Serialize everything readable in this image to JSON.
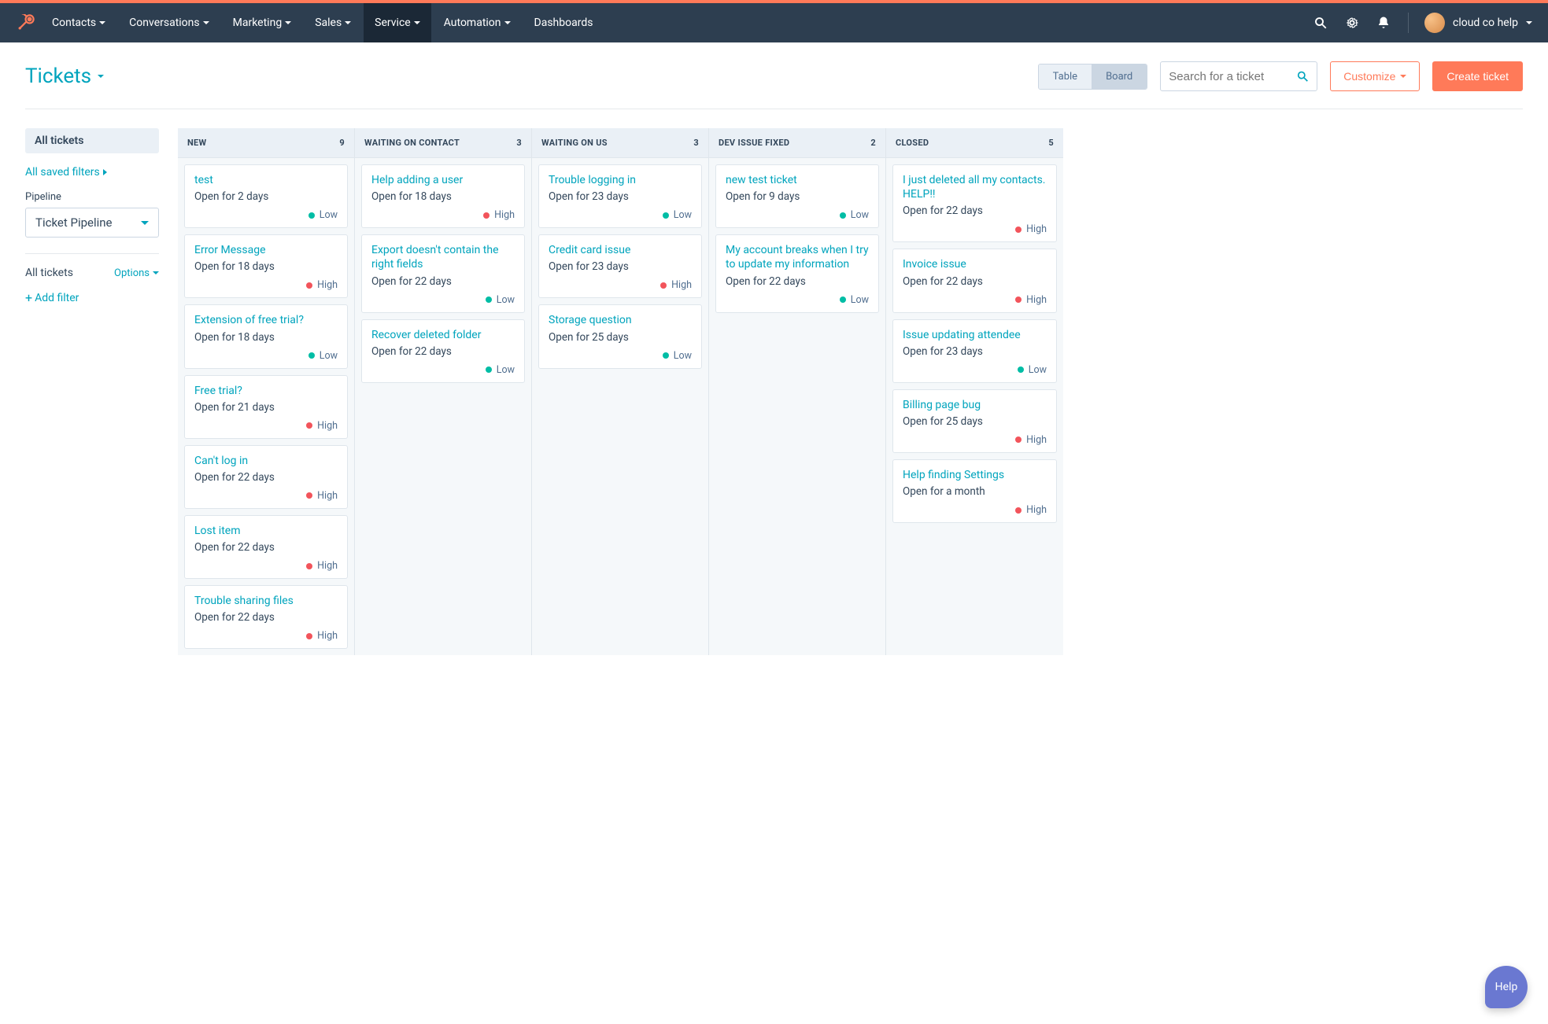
{
  "nav": {
    "items": [
      {
        "label": "Contacts"
      },
      {
        "label": "Conversations"
      },
      {
        "label": "Marketing"
      },
      {
        "label": "Sales"
      },
      {
        "label": "Service"
      },
      {
        "label": "Automation"
      },
      {
        "label": "Dashboards"
      }
    ],
    "account_name": "cloud co help"
  },
  "header": {
    "title": "Tickets",
    "view_table": "Table",
    "view_board": "Board",
    "search_placeholder": "Search for a ticket",
    "customize": "Customize",
    "create": "Create ticket"
  },
  "sidebar": {
    "all_tickets_pill": "All tickets",
    "saved_filters": "All saved filters",
    "pipeline_label": "Pipeline",
    "pipeline_value": "Ticket Pipeline",
    "subhead": "All tickets",
    "options": "Options",
    "add_filter": "Add filter"
  },
  "board": {
    "columns": [
      {
        "name": "NEW",
        "count": "9",
        "cards": [
          {
            "title": "test",
            "sub": "Open for 2 days",
            "pri": "Low"
          },
          {
            "title": "Error Message",
            "sub": "Open for 18 days",
            "pri": "High"
          },
          {
            "title": "Extension of free trial?",
            "sub": "Open for 18 days",
            "pri": "Low"
          },
          {
            "title": "Free trial?",
            "sub": "Open for 21 days",
            "pri": "High"
          },
          {
            "title": "Can't log in",
            "sub": "Open for 22 days",
            "pri": "High"
          },
          {
            "title": "Lost item",
            "sub": "Open for 22 days",
            "pri": "High"
          },
          {
            "title": "Trouble sharing files",
            "sub": "Open for 22 days",
            "pri": "High"
          }
        ]
      },
      {
        "name": "WAITING ON CONTACT",
        "count": "3",
        "cards": [
          {
            "title": "Help adding a user",
            "sub": "Open for 18 days",
            "pri": "High"
          },
          {
            "title": "Export doesn't contain the right fields",
            "sub": "Open for 22 days",
            "pri": "Low"
          },
          {
            "title": "Recover deleted folder",
            "sub": "Open for 22 days",
            "pri": "Low"
          }
        ]
      },
      {
        "name": "WAITING ON US",
        "count": "3",
        "cards": [
          {
            "title": "Trouble logging in",
            "sub": "Open for 23 days",
            "pri": "Low"
          },
          {
            "title": "Credit card issue",
            "sub": "Open for 23 days",
            "pri": "High"
          },
          {
            "title": "Storage question",
            "sub": "Open for 25 days",
            "pri": "Low"
          }
        ]
      },
      {
        "name": "DEV ISSUE FIXED",
        "count": "2",
        "cards": [
          {
            "title": "new test ticket",
            "sub": "Open for 9 days",
            "pri": "Low"
          },
          {
            "title": "My account breaks when I try to update my information",
            "sub": "Open for 22 days",
            "pri": "Low"
          }
        ]
      },
      {
        "name": "CLOSED",
        "count": "5",
        "cards": [
          {
            "title": "I just deleted all my contacts. HELP!!",
            "sub": "Open for 22 days",
            "pri": "High"
          },
          {
            "title": "Invoice issue",
            "sub": "Open for 22 days",
            "pri": "High"
          },
          {
            "title": "Issue updating attendee",
            "sub": "Open for 23 days",
            "pri": "Low"
          },
          {
            "title": "Billing page bug",
            "sub": "Open for 25 days",
            "pri": "High"
          },
          {
            "title": "Help finding Settings",
            "sub": "Open for a month",
            "pri": "High"
          }
        ]
      }
    ]
  },
  "help": "Help"
}
